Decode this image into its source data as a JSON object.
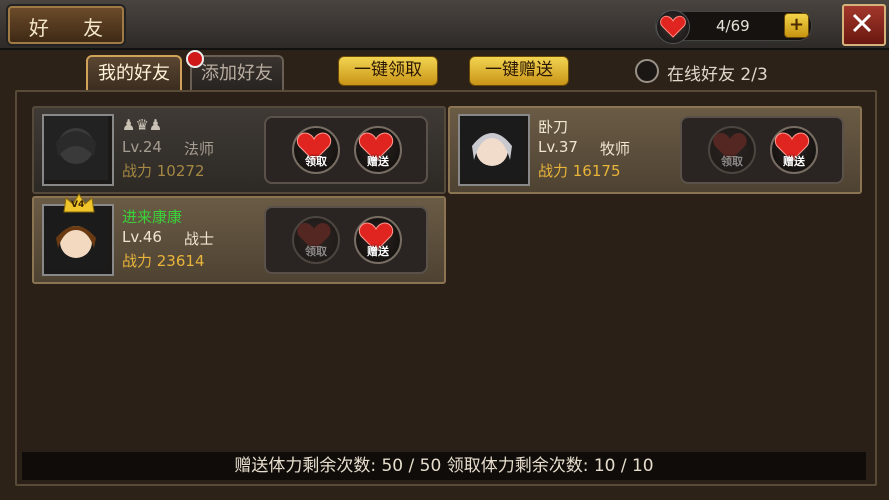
{
  "header": {
    "title": "好 友",
    "hearts": "4/69",
    "plus_label": "+"
  },
  "tabs": [
    {
      "label": "我的好友",
      "active": true
    },
    {
      "label": "添加好友",
      "active": false
    }
  ],
  "actions": {
    "claim_all": "一键领取",
    "send_all": "一键赠送"
  },
  "online": {
    "label": "在线好友 2/3"
  },
  "friends": [
    {
      "name": "",
      "level": "Lv.24",
      "class": "法师",
      "power": "战力 10272",
      "online": false,
      "claim_enabled": true,
      "send_enabled": true,
      "rank_icons": "♟♛♟"
    },
    {
      "name": "卧刀",
      "level": "Lv.37",
      "class": "牧师",
      "power": "战力 16175",
      "online": true,
      "claim_enabled": false,
      "send_enabled": true
    },
    {
      "name": "进来康康",
      "level": "Lv.46",
      "class": "战士",
      "power": "战力 23614",
      "online": true,
      "claim_enabled": false,
      "send_enabled": true,
      "vip": "V4"
    }
  ],
  "buttons": {
    "claim": "领取",
    "send": "赠送"
  },
  "footer": {
    "text": "赠送体力剩余次数: 50 / 50    领取体力剩余次数: 10 / 10"
  },
  "colors": {
    "accent": "#e9b43a",
    "heart": "#e0241f",
    "online_name": "#3ad13a"
  }
}
